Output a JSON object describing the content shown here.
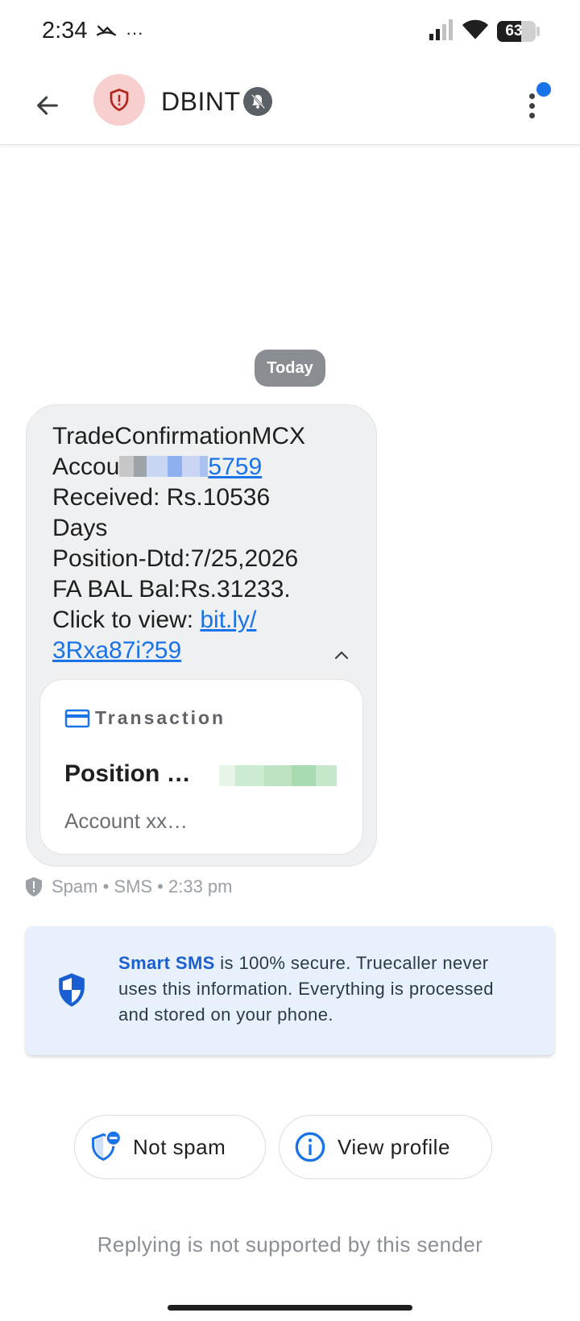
{
  "status_bar": {
    "time": "2:34",
    "more_notifications": "···",
    "battery_level": "63",
    "battery_fraction": 0.63
  },
  "app_bar": {
    "sender_name": "DBINT",
    "avatar_color": "#f7cfcf",
    "accent_color": "#1a73e8"
  },
  "conversation": {
    "date_chip": "Today",
    "message": {
      "line1": "TradeConfirmationMCX",
      "line2_prefix": "Accou",
      "line2_link": "5759",
      "line3": "Received: Rs.10536",
      "line4": "Days",
      "line5": "Position-Dtd:7/25,2026",
      "line6": "FA BAL Bal:Rs.31233.",
      "line7_prefix": "Click to view: ",
      "line7_link": "bit.ly/",
      "line8_link": "3Rxa87i?59"
    },
    "card": {
      "label": "Transaction",
      "title": "Position …",
      "subtitle": "Account xx…"
    },
    "meta": "Spam • SMS • 2:33 pm"
  },
  "info_banner": {
    "strong": "Smart SMS",
    "text": " is 100% secure. Truecaller never uses this information. Everything is processed and stored on your phone."
  },
  "actions": {
    "not_spam": "Not spam",
    "view_profile": "View profile"
  },
  "footer": {
    "reply_note": "Replying is not supported by this sender"
  }
}
